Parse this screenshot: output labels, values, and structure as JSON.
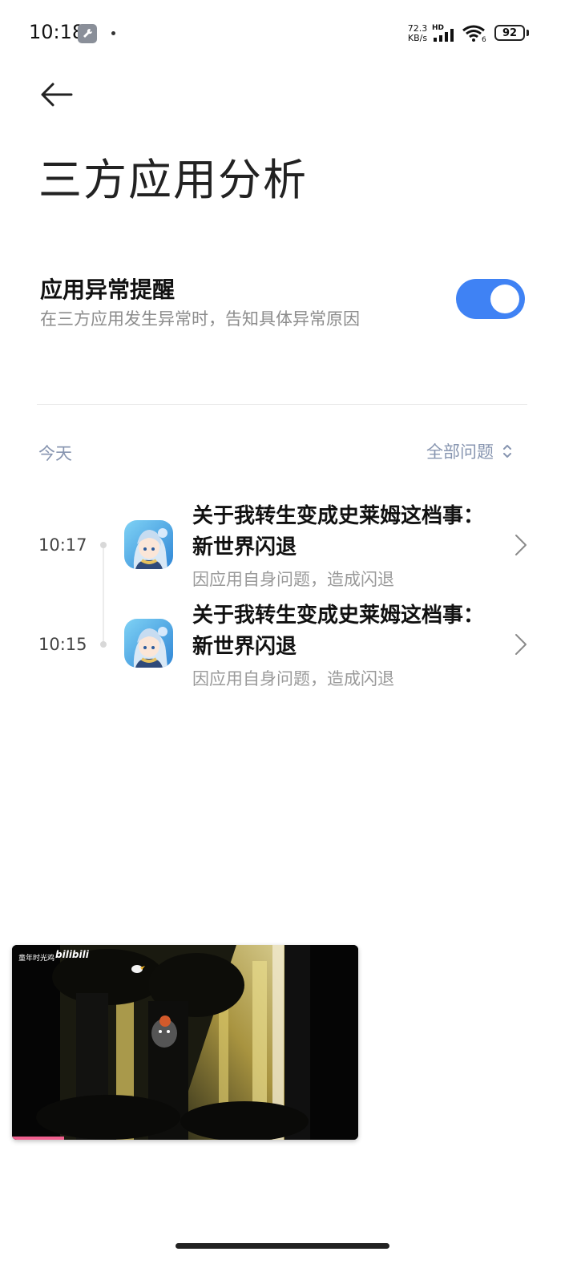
{
  "status_bar": {
    "time": "10:18",
    "net_speed_value": "72.3",
    "net_speed_unit": "KB/s",
    "network_type": "HD",
    "wifi_sub": "6",
    "battery": "92"
  },
  "header": {
    "title": "三方应用分析"
  },
  "setting": {
    "title": "应用异常提醒",
    "description": "在三方应用发生异常时，告知具体异常原因",
    "enabled": true
  },
  "filter": {
    "date_label": "今天",
    "selected": "全部问题"
  },
  "events": [
    {
      "time": "10:17",
      "title": "关于我转生变成史莱姆这档事：新世界闪退",
      "subtitle": "因应用自身问题，造成闪退"
    },
    {
      "time": "10:15",
      "title": "关于我转生变成史莱姆这档事：新世界闪退",
      "subtitle": "因应用自身问题，造成闪退"
    }
  ],
  "pip_video": {
    "channel": "童年时光鸡",
    "brand": "bilibili",
    "progress": 0.15
  },
  "colors": {
    "accent": "#3f82f4",
    "muted_blue": "#8795b0",
    "progress": "#f0608f"
  }
}
